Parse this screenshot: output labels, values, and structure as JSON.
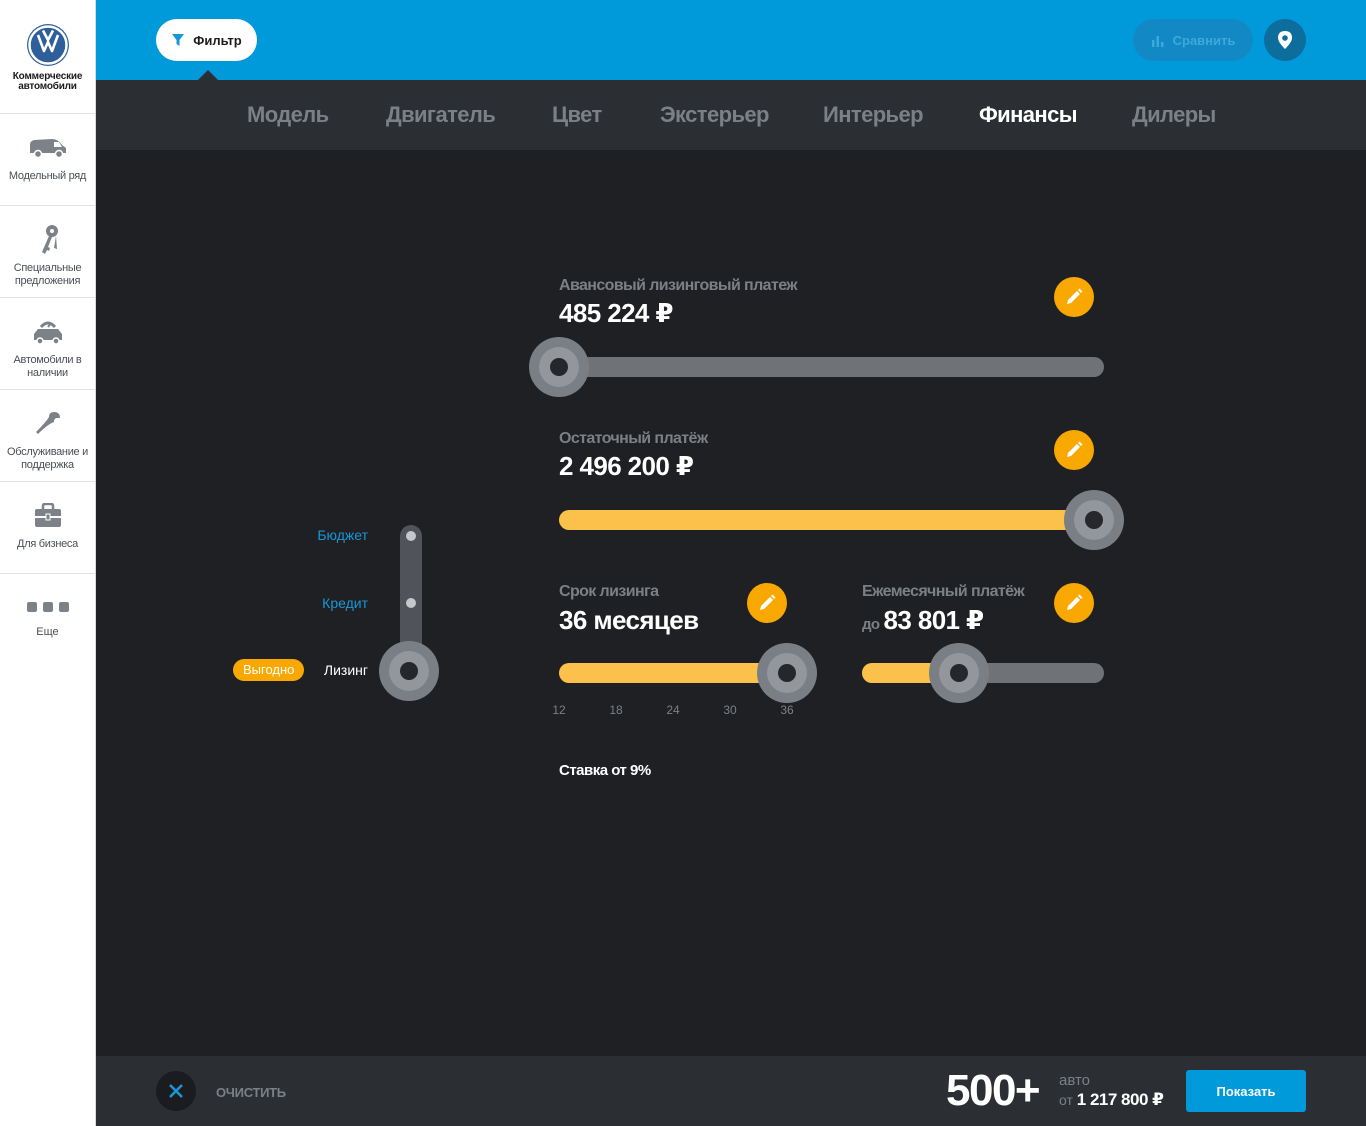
{
  "brand": {
    "name": "Коммерческие автомобили",
    "logo_icon": "vw-logo"
  },
  "sidebar": {
    "items": [
      {
        "label": "Модельный ряд",
        "icon": "van-icon"
      },
      {
        "label": "Специальные предложения",
        "icon": "keys-icon"
      },
      {
        "label": "Автомобили в наличии",
        "icon": "car-in-stock-icon"
      },
      {
        "label": "Обслуживание и поддержка",
        "icon": "wrench-icon"
      },
      {
        "label": "Для бизнеса",
        "icon": "briefcase-icon"
      }
    ],
    "more_label": "Еще"
  },
  "topbar": {
    "filter_label": "Фильтр",
    "compare_label": "Сравнить",
    "background_color": "#0099da"
  },
  "tabs": [
    {
      "label": "Модель",
      "active": false
    },
    {
      "label": "Двигатель",
      "active": false
    },
    {
      "label": "Цвет",
      "active": false
    },
    {
      "label": "Экстерьер",
      "active": false
    },
    {
      "label": "Интерьер",
      "active": false
    },
    {
      "label": "Финансы",
      "active": true
    },
    {
      "label": "Дилеры",
      "active": false
    }
  ],
  "finance": {
    "modes": {
      "options": [
        "Бюджет",
        "Кредит",
        "Лизинг"
      ],
      "selected": "Лизинг",
      "badge": "Выгодно"
    },
    "advance_payment": {
      "label": "Авансовый лизинговый платеж",
      "value": "485 224 ₽",
      "slider_fraction": 0.0
    },
    "residual_payment": {
      "label": "Остаточный платёж",
      "value": "2 496 200 ₽",
      "slider_fraction": 1.0
    },
    "lease_term": {
      "label": "Срок лизинга",
      "value": "36 месяцев",
      "ticks": [
        "12",
        "18",
        "24",
        "30",
        "36"
      ],
      "selected_months": 36
    },
    "monthly_payment": {
      "label": "Ежемесячный платёж",
      "prefix": "до",
      "value": "83 801 ₽",
      "slider_fraction": 0.4
    },
    "rate": "Ставка от 9%",
    "accent_color": "#fbc14a",
    "edit_color": "#f8a800"
  },
  "bottombar": {
    "clear_label": "ОЧИСТИТЬ",
    "count": "500+",
    "count_unit": "авто",
    "price_prefix": "от",
    "price": "1 217 800 ₽",
    "show_label": "Показать"
  }
}
